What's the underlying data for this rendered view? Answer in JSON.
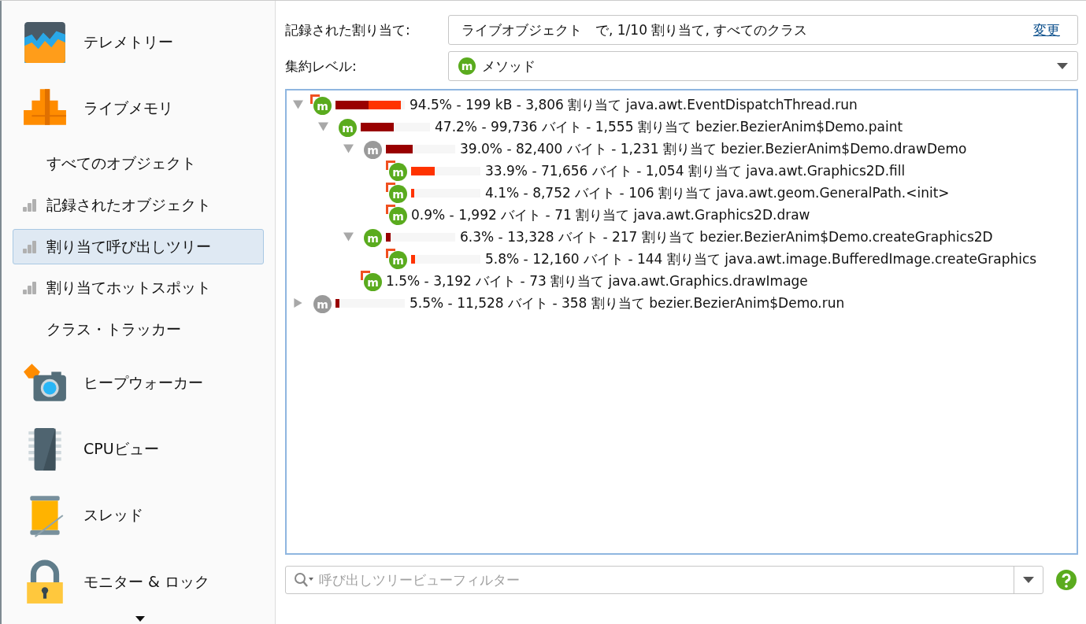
{
  "sidebar": {
    "sections": [
      {
        "kind": "telemetry",
        "label": "テレメトリー"
      },
      {
        "kind": "memory",
        "label": "ライブメモリ",
        "items": [
          {
            "label": "すべてのオブジェクト",
            "recorded": false,
            "selected": false
          },
          {
            "label": "記録されたオブジェクト",
            "recorded": true,
            "selected": false
          },
          {
            "label": "割り当て呼び出しツリー",
            "recorded": true,
            "selected": true
          },
          {
            "label": "割り当てホットスポット",
            "recorded": true,
            "selected": false
          },
          {
            "label": "クラス・トラッカー",
            "recorded": false,
            "selected": false
          }
        ]
      },
      {
        "kind": "heap",
        "label": "ヒープウォーカー"
      },
      {
        "kind": "cpu",
        "label": "CPUビュー"
      },
      {
        "kind": "thread",
        "label": "スレッド"
      },
      {
        "kind": "lock",
        "label": "モニター & ロック"
      }
    ]
  },
  "recorded": {
    "label": "記録された割り当て:",
    "value": "ライブオブジェクト　で, 1/10 割り当て, すべてのクラス",
    "link": "変更"
  },
  "aggregation": {
    "label": "集約レベル:",
    "badge": "m",
    "value": "メソッド"
  },
  "tree": [
    {
      "text": "94.5% - 199 kB - 3,806 割り当て java.awt.EventDispatchThread.run",
      "kind": "method",
      "badge": "m",
      "hot": true,
      "expanded": true,
      "bar": [
        {
          "kind": "dark",
          "level": 0.48
        },
        {
          "kind": "bright",
          "level": 0.465
        }
      ],
      "children": [
        {
          "text": "47.2% - 99,736 バイト - 1,555 割り当て bezier.BezierAnim$Demo.paint",
          "kind": "method",
          "badge": "m",
          "hot": false,
          "expanded": true,
          "bar": [
            {
              "kind": "dark",
              "level": 0.472
            }
          ],
          "children": [
            {
              "text": "39.0% - 82,400 バイト - 1,231 割り当て bezier.BezierAnim$Demo.drawDemo",
              "kind": "filtered",
              "badge": "m",
              "hot": false,
              "expanded": true,
              "bar": [
                {
                  "kind": "dark",
                  "level": 0.39
                }
              ],
              "children": [
                {
                  "text": "33.9% - 71,656 バイト - 1,054 割り当て java.awt.Graphics2D.fill",
                  "kind": "method",
                  "badge": "m",
                  "hot": true,
                  "bar": [
                    {
                      "kind": "bright",
                      "level": 0.339
                    }
                  ]
                },
                {
                  "text": "4.1% - 8,752 バイト - 106 割り当て java.awt.geom.GeneralPath.<init>",
                  "kind": "method",
                  "badge": "m",
                  "hot": true,
                  "bar": [
                    {
                      "kind": "bright",
                      "level": 0.041
                    }
                  ]
                },
                {
                  "text": "0.9% - 1,992 バイト - 71 割り当て java.awt.Graphics2D.draw",
                  "kind": "method",
                  "badge": "m",
                  "hot": true
                }
              ]
            },
            {
              "text": "6.3% - 13,328 バイト - 217 割り当て bezier.BezierAnim$Demo.createGraphics2D",
              "kind": "method",
              "badge": "m",
              "hot": false,
              "expanded": true,
              "bar": [
                {
                  "kind": "dark",
                  "level": 0.063
                }
              ],
              "children": [
                {
                  "text": "5.8% - 12,160 バイト - 144 割り当て java.awt.image.BufferedImage.createGraphics",
                  "kind": "method",
                  "badge": "m",
                  "hot": true,
                  "bar": [
                    {
                      "kind": "bright",
                      "level": 0.058
                    }
                  ]
                }
              ]
            },
            {
              "text": "1.5% - 3,192 バイト - 73 割り当て java.awt.Graphics.drawImage",
              "kind": "method",
              "badge": "m",
              "hot": true
            }
          ]
        }
      ]
    },
    {
      "text": "5.5% - 11,528 バイト - 358 割り当て bezier.BezierAnim$Demo.run",
      "kind": "filtered",
      "badge": "m",
      "hot": false,
      "expanded": false,
      "bar": [
        {
          "kind": "dark",
          "level": 0.055
        }
      ]
    }
  ],
  "filter": {
    "placeholder": "呼び出しツリービューフィルター"
  }
}
